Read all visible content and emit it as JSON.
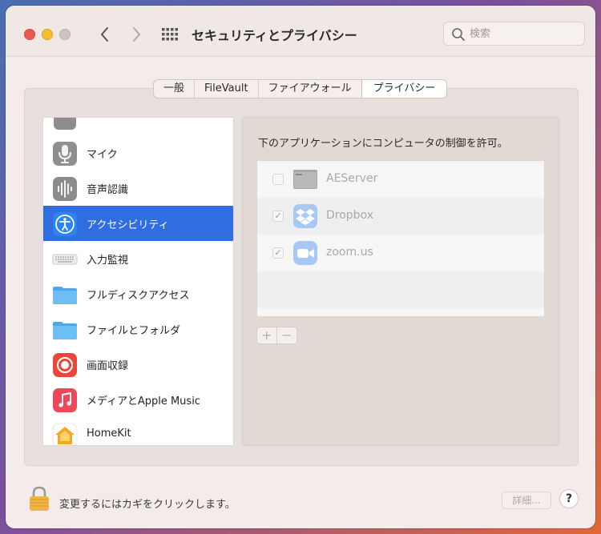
{
  "window": {
    "title": "セキュリティとプライバシー",
    "search_placeholder": "検索"
  },
  "tabs": [
    {
      "label": "一般",
      "active": false
    },
    {
      "label": "FileVault",
      "active": false
    },
    {
      "label": "ファイアウォール",
      "active": false
    },
    {
      "label": "プライバシー",
      "active": true
    }
  ],
  "sidebar": {
    "items": [
      {
        "label": "",
        "icon": "partial-icon",
        "selected": false
      },
      {
        "label": "マイク",
        "icon": "microphone-icon",
        "selected": false
      },
      {
        "label": "音声認識",
        "icon": "speech-recognition-icon",
        "selected": false
      },
      {
        "label": "アクセシビリティ",
        "icon": "accessibility-icon",
        "selected": true
      },
      {
        "label": "入力監視",
        "icon": "keyboard-icon",
        "selected": false
      },
      {
        "label": "フルディスクアクセス",
        "icon": "folder-icon",
        "selected": false
      },
      {
        "label": "ファイルとフォルダ",
        "icon": "folder-icon",
        "selected": false
      },
      {
        "label": "画面収録",
        "icon": "screen-recording-icon",
        "selected": false
      },
      {
        "label": "メディアとApple Music",
        "icon": "music-icon",
        "selected": false
      },
      {
        "label": "HomeKit",
        "icon": "homekit-icon",
        "selected": false
      }
    ]
  },
  "main": {
    "allow_label": "下のアプリケーションにコンピュータの制御を許可。",
    "apps": [
      {
        "name": "AEServer",
        "checked": false,
        "icon": "terminal-icon"
      },
      {
        "name": "Dropbox",
        "checked": true,
        "icon": "dropbox-icon"
      },
      {
        "name": "zoom.us",
        "checked": true,
        "icon": "zoom-icon"
      }
    ],
    "add_label": "+",
    "remove_label": "−"
  },
  "footer": {
    "lock_text": "変更するにはカギをクリックします。",
    "details_label": "詳細...",
    "help_label": "?"
  },
  "colors": {
    "selection": "#2f6de0",
    "close": "#ee5a52",
    "minimize": "#f5bd2f"
  }
}
